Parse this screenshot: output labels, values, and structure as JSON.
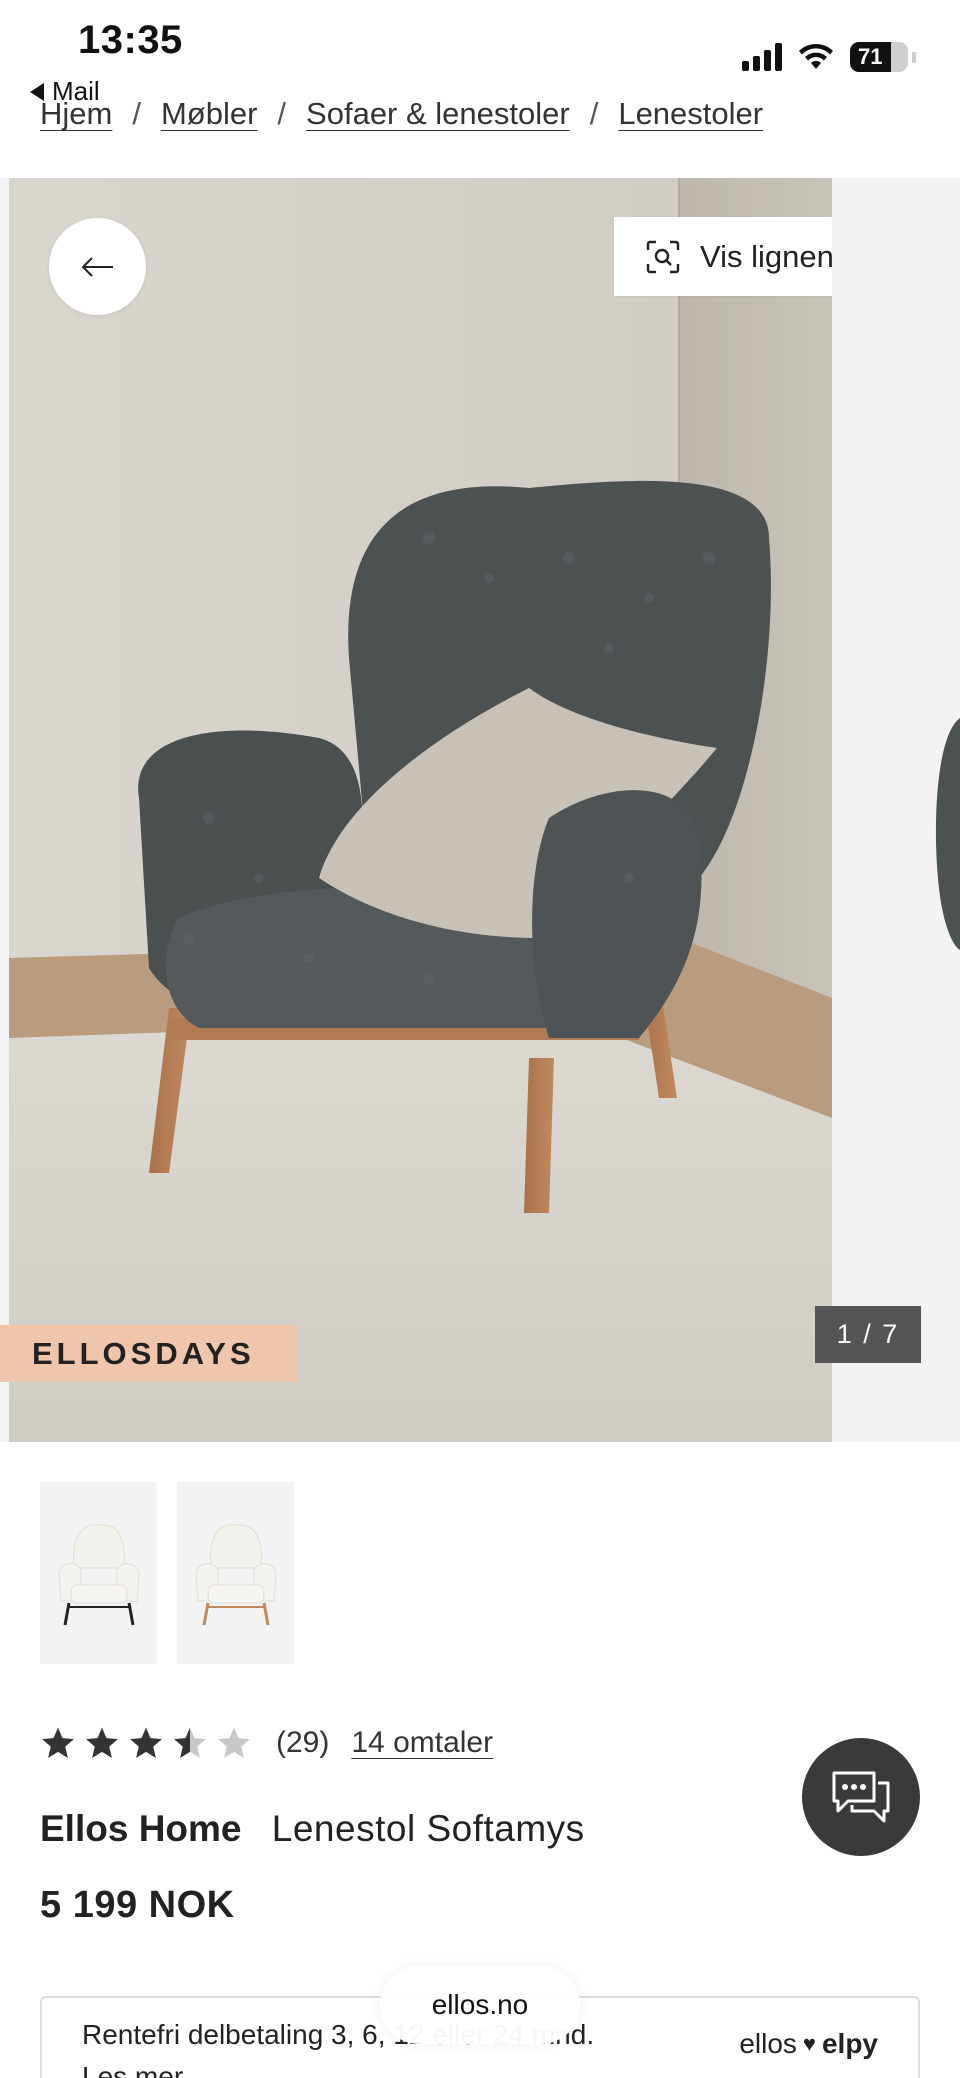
{
  "status_bar": {
    "time": "13:35",
    "back_app": "Mail",
    "battery": "71"
  },
  "breadcrumb": [
    "Hjem",
    "Møbler",
    "Sofaer & lenestoler",
    "Lenestoler"
  ],
  "gallery": {
    "similar_label": "Vis lignende",
    "promo_tag": "ELLOSDAYS",
    "counter": "1 / 7",
    "thumbnail_count": 2
  },
  "product": {
    "rating": 3.5,
    "rating_max": 5,
    "rating_count": "(29)",
    "reviews_link": "14 omtaler",
    "brand": "Ellos Home",
    "name": "Lenestol Softamys",
    "price": "5 199 NOK"
  },
  "payment": {
    "text": "Rentefri delbetaling 3, 6, 12 eller 24 mnd.",
    "link": "Les mer",
    "logo_left": "ellos",
    "logo_right": "elpy"
  },
  "browser": {
    "url": "ellos.no"
  },
  "colors": {
    "promo_bg": "#efc6ac",
    "chat_bg": "#3a3a3a",
    "counter_bg": "#555555"
  }
}
